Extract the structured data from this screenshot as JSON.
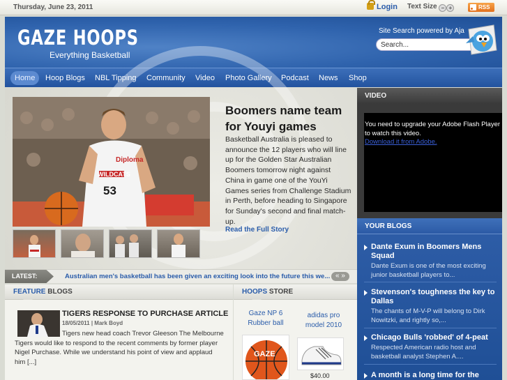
{
  "topbar": {
    "date": "Thursday, June 23, 2011",
    "login_label": "Login",
    "text_size_label": "Text Size",
    "text_size_minus": "−",
    "text_size_plus": "+",
    "rss_label": "RSS"
  },
  "header": {
    "logo_title": "GAZE HOOPS",
    "logo_subtitle": "Everything Basketball",
    "search_label": "Site Search powered by Aja",
    "search_value": "Search..."
  },
  "nav": {
    "items": [
      "Home",
      "Hoop Blogs",
      "NBL Tipping",
      "Community",
      "Video",
      "Photo Gallery",
      "Podcast",
      "News",
      "Shop"
    ],
    "active": "Home"
  },
  "feature": {
    "headline": "Boomers name team for Youyi games",
    "lede": "Basketball Australia is pleased to announce the 12 players who will line up for the Golden Star Australian Boomers tomorrow night against China in game one of the YouYi Games series from Challenge Stadium in Perth, before heading to Singapore for Sunday's second and final match-up.",
    "read_more": "Read the Full Story",
    "jersey_text": "WILDCATS",
    "jersey_number": "53",
    "sponsor_text": "Diploma"
  },
  "latest": {
    "label": "LATEST:",
    "ticker": "Australian men's basketball has been given an exciting look into the future this we...",
    "arrows": "« »"
  },
  "feature_blogs": {
    "heading_hl": "FEATURE",
    "heading_rest": " BLOGS",
    "title": "TIGERS RESPONSE TO PURCHASE ARTICLE",
    "meta": "18/05/2011 | Mark Boyd",
    "text": "Tigers new head coach Trevor Gleeson The Melbourne Tigers would like to respond to the recent comments by former player Nigel Purchase. While we understand his point of view and applaud him [...]"
  },
  "store": {
    "heading_hl": "HOOPS",
    "heading_rest": " STORE",
    "products": [
      {
        "name": "Gaze NP 6 Rubber ball",
        "price": ""
      },
      {
        "name": "adidas pro model 2010",
        "price": "$40.00"
      }
    ],
    "ball_brand": "GAZE"
  },
  "video": {
    "heading": "VIDEO",
    "message": "You need to upgrade your Adobe Flash Player to watch this video.",
    "link": "Download it from Adobe."
  },
  "your_blogs": {
    "heading_hl": "YOUR",
    "heading_rest": " BLOGS",
    "items": [
      {
        "title": "Dante Exum in Boomers Mens Squad",
        "text": "Dante Exum is one of the most exciting junior basketball players to..."
      },
      {
        "title": "Stevenson's toughness the key to Dallas",
        "text": "The chants of M-V-P will belong to Dirk Nowitzki, and rightly so,..."
      },
      {
        "title": "Chicago Bulls 'robbed' of 4-peat",
        "text": "Respected American radio host and basketball analyst Stephen A...."
      },
      {
        "title": "A month is a long time for the",
        "text": ""
      }
    ]
  },
  "colors": {
    "brand_blue": "#2f63ad",
    "link_blue": "#2a5caa",
    "rss_orange": "#e2701c"
  }
}
